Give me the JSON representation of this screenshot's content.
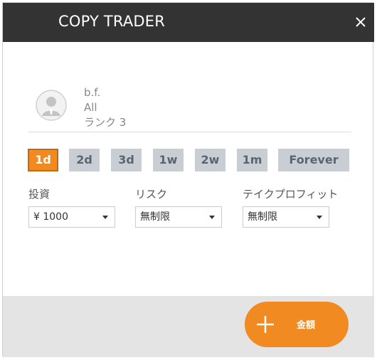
{
  "header": {
    "title": "COPY TRADER",
    "close_icon": "close-icon"
  },
  "profile": {
    "avatar_icon": "user-avatar-icon",
    "name": "b.f.",
    "category": "All",
    "rank": "ランク 3"
  },
  "periods": {
    "items": [
      {
        "label": "1d",
        "active": true
      },
      {
        "label": "2d",
        "active": false
      },
      {
        "label": "3d",
        "active": false
      },
      {
        "label": "1w",
        "active": false
      },
      {
        "label": "2w",
        "active": false
      },
      {
        "label": "1m",
        "active": false
      },
      {
        "label": "Forever",
        "active": false
      }
    ]
  },
  "fields": {
    "investment": {
      "label": "投資",
      "value": "¥ 1000"
    },
    "risk": {
      "label": "リスク",
      "value": "無制限"
    },
    "take_profit": {
      "label": "テイクプロフィット",
      "value": "無制限"
    }
  },
  "footer": {
    "amount_label": "金額",
    "plus_icon": "plus-icon"
  },
  "colors": {
    "header_bg": "#333333",
    "accent": "#f28a22",
    "period_bg": "#c9ced4",
    "footer_bg": "#e4e4e4"
  }
}
